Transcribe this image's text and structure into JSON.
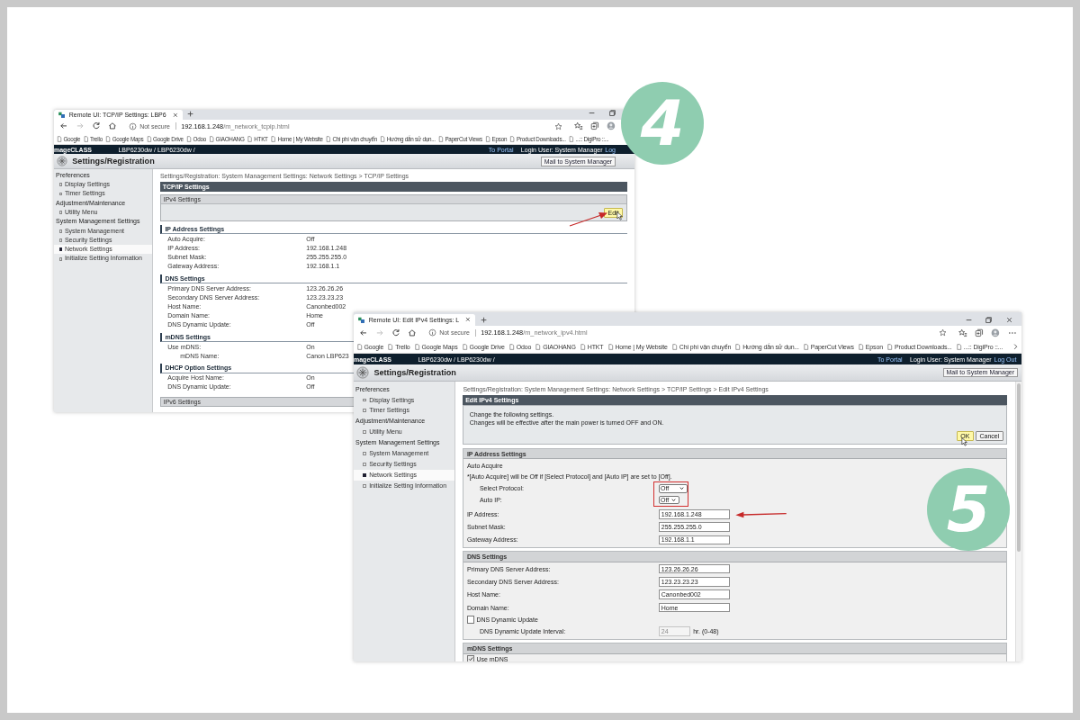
{
  "windows": [
    {
      "kind": "view",
      "tab_title": "Remote UI: TCP/IP Settings: LBP6",
      "url": {
        "security": "Not secure",
        "host": "192.168.1.248",
        "path": "/m_network_tcpip.html"
      },
      "bookmarks": [
        "Google",
        "Trello",
        "Google Maps",
        "Google Drive",
        "Odoo",
        "GIAOHANG",
        "HTKT",
        "Home | My Website",
        "Chi phí vận chuyển",
        "Hướng dẫn sử dụn...",
        "PaperCut Views",
        "Epson",
        "Product Downloads...",
        "...:: DigiPro ::..."
      ],
      "header": {
        "brand": "mageCLASS",
        "model": "LBP6230dw / LBP6230dw /",
        "portal_link": "To Portal",
        "login_text": "Login User: System Manager",
        "logout_link": "Log"
      },
      "page_title": "Settings/Registration",
      "mail_button": "Mail to System Manager",
      "sidebar": [
        {
          "label": "Preferences",
          "items": [
            {
              "label": "Display Settings",
              "selected": false
            },
            {
              "label": "Timer Settings",
              "selected": false
            }
          ]
        },
        {
          "label": "Adjustment/Maintenance",
          "items": [
            {
              "label": "Utility Menu",
              "selected": false
            }
          ]
        },
        {
          "label": "System Management Settings",
          "items": [
            {
              "label": "System Management",
              "selected": false
            },
            {
              "label": "Security Settings",
              "selected": false
            },
            {
              "label": "Network Settings",
              "selected": true
            },
            {
              "label": "Initialize Setting Information",
              "selected": false
            }
          ]
        }
      ],
      "breadcrumb": "Settings/Registration: System Management Settings: Network Settings > TCP/IP Settings",
      "title": "TCP/IP Settings",
      "panel": {
        "title": "IPv4 Settings",
        "button": "Edit"
      },
      "sections": [
        {
          "title": "IP Address Settings",
          "rows": [
            {
              "label": "Auto Acquire:",
              "value": "Off"
            },
            {
              "label": "IP Address:",
              "value": "192.168.1.248"
            },
            {
              "label": "Subnet Mask:",
              "value": "255.255.255.0"
            },
            {
              "label": "Gateway Address:",
              "value": "192.168.1.1"
            }
          ]
        },
        {
          "title": "DNS Settings",
          "rows": [
            {
              "label": "Primary DNS Server Address:",
              "value": "123.26.26.26"
            },
            {
              "label": "Secondary DNS Server Address:",
              "value": "123.23.23.23"
            },
            {
              "label": "Host Name:",
              "value": "Canonbed002"
            },
            {
              "label": "Domain Name:",
              "value": "Home"
            },
            {
              "label": "DNS Dynamic Update:",
              "value": "Off"
            }
          ]
        },
        {
          "title": "mDNS Settings",
          "rows": [
            {
              "label": "Use mDNS:",
              "value": "On"
            },
            {
              "label": "mDNS Name:",
              "value": "Canon LBP623",
              "indent": true
            }
          ]
        },
        {
          "title": "DHCP Option Settings",
          "rows": [
            {
              "label": "Acquire Host Name:",
              "value": "On"
            },
            {
              "label": "DNS Dynamic Update:",
              "value": "Off"
            }
          ]
        }
      ],
      "footer_bar": "IPv6 Settings"
    },
    {
      "kind": "edit",
      "tab_title": "Remote UI: Edit IPv4 Settings: L",
      "url": {
        "security": "Not secure",
        "host": "192.168.1.248",
        "path": "/m_network_ipv4.html"
      },
      "bookmarks": [
        "Google",
        "Trello",
        "Google Maps",
        "Google Drive",
        "Odoo",
        "GIAOHANG",
        "HTKT",
        "Home | My Website",
        "Chi phí vận chuyển",
        "Hướng dẫn sử dụn...",
        "PaperCut Views",
        "Epson",
        "Product Downloads...",
        "...:: DigiPro ::..."
      ],
      "header": {
        "brand": "mageCLASS",
        "model": "LBP6230dw / LBP6230dw /",
        "portal_link": "To Portal",
        "login_text": "Login User: System Manager",
        "logout_link": "Log Out"
      },
      "page_title": "Settings/Registration",
      "mail_button": "Mail to System Manager",
      "sidebar": [
        {
          "label": "Preferences",
          "items": [
            {
              "label": "Display Settings",
              "selected": false
            },
            {
              "label": "Timer Settings",
              "selected": false
            }
          ]
        },
        {
          "label": "Adjustment/Maintenance",
          "items": [
            {
              "label": "Utility Menu",
              "selected": false
            }
          ]
        },
        {
          "label": "System Management Settings",
          "items": [
            {
              "label": "System Management",
              "selected": false
            },
            {
              "label": "Security Settings",
              "selected": false
            },
            {
              "label": "Network Settings",
              "selected": true
            },
            {
              "label": "Initialize Setting Information",
              "selected": false
            }
          ]
        }
      ],
      "breadcrumb": "Settings/Registration: System Management Settings: Network Settings > TCP/IP Settings > Edit IPv4 Settings",
      "title": "Edit IPv4 Settings",
      "notice": [
        "Change the following settings.",
        "Changes will be effective after the main power is turned OFF and ON."
      ],
      "buttons": [
        {
          "label": "OK",
          "kind": "primary"
        },
        {
          "label": "Cancel",
          "kind": "normal"
        }
      ],
      "sections": [
        {
          "title": "IP Address Settings",
          "rows": [
            {
              "kind": "label",
              "label": "Auto Acquire"
            },
            {
              "kind": "note",
              "label": "*[Auto Acquire] will be Off if [Select Protocol] and [Auto IP] are set to [Off]."
            },
            {
              "kind": "select",
              "label": "Select Protocol:",
              "value": "Off",
              "indent": true
            },
            {
              "kind": "select",
              "label": "Auto IP:",
              "value": "Off",
              "indent": true
            },
            {
              "kind": "input",
              "label": "IP Address:",
              "value": "192.168.1.248"
            },
            {
              "kind": "input",
              "label": "Subnet Mask:",
              "value": "255.255.255.0"
            },
            {
              "kind": "input",
              "label": "Gateway Address:",
              "value": "192.168.1.1"
            }
          ]
        },
        {
          "title": "DNS Settings",
          "rows": [
            {
              "kind": "input",
              "label": "Primary DNS Server Address:",
              "value": "123.26.26.26"
            },
            {
              "kind": "input",
              "label": "Secondary DNS Server Address:",
              "value": "123.23.23.23"
            },
            {
              "kind": "input",
              "label": "Host Name:",
              "value": "Canonbed002"
            },
            {
              "kind": "input",
              "label": "Domain Name:",
              "value": "Home"
            },
            {
              "kind": "checkbox",
              "label": "DNS Dynamic Update",
              "checked": false
            },
            {
              "kind": "interval",
              "label": "DNS Dynamic Update Interval:",
              "value": "24",
              "unit": "hr. (0-48)",
              "disabled": true,
              "indent": true
            }
          ]
        },
        {
          "title": "mDNS Settings",
          "rows": [
            {
              "kind": "checkbox",
              "label": "Use mDNS",
              "checked": true
            }
          ]
        }
      ]
    }
  ],
  "step_badges": [
    "4",
    "5"
  ]
}
